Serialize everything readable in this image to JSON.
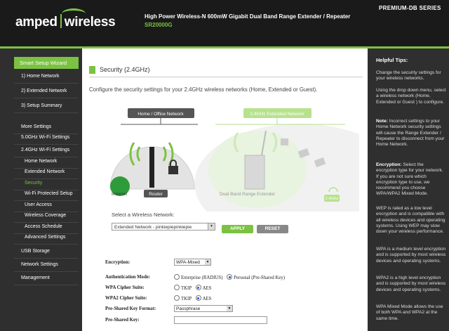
{
  "header": {
    "brand_left": "amped",
    "brand_right": "wireless",
    "product_title": "High Power Wireless-N 600mW Gigabit Dual Band Range Extender / Repeater",
    "model": "SR20000G",
    "series": "PREMIUM-DB SERIES"
  },
  "sidebar": {
    "wizard": "Smart Setup Wizard",
    "items": [
      {
        "label": "1) Home Network"
      },
      {
        "label": "2) Extended Network"
      },
      {
        "label": "3) Setup Summary"
      },
      {
        "label": "More Settings"
      },
      {
        "label": "5.0GHz Wi-Fi Settings"
      },
      {
        "label": "2.4GHz Wi-Fi Settings"
      },
      {
        "label": "Home Network"
      },
      {
        "label": "Extended Network"
      },
      {
        "label": "Security"
      },
      {
        "label": "Wi-Fi Protected Setup"
      },
      {
        "label": "User Access"
      },
      {
        "label": "Wireless Coverage"
      },
      {
        "label": "Access Schedule"
      },
      {
        "label": "Advanced Settings"
      },
      {
        "label": "USB Storage"
      },
      {
        "label": "Network Settings"
      },
      {
        "label": "Management"
      }
    ]
  },
  "main": {
    "title": "Security (2.4GHz)",
    "description": "Configure the security settings for your 2.4GHz wireless networks (Home, Extended or Guest).",
    "diagram": {
      "home_label": "Home / Office Network",
      "extended_label": "2.4GHz Extended Network",
      "internet": "Internet",
      "router": "Router",
      "extender": "Dual Band Range Extender",
      "badge": "2.4GHz"
    },
    "select_label": "Select a Wireless Network:",
    "selected_network": "Extended Network - pinkiepiepinkiepie",
    "apply": "APPLY",
    "reset": "RESET",
    "form": {
      "encryption_label": "Encryption:",
      "encryption_value": "WPA-Mixed",
      "auth_label": "Authentication Mode:",
      "auth_opt1": "Enterprise (RADIUS)",
      "auth_opt2": "Personal (Pre-Shared Key)",
      "wpa_label": "WPA Cipher Suite:",
      "wpa2_label": "WPA2 Cipher Suite:",
      "tkip": "TKIP",
      "aes": "AES",
      "psk_format_label": "Pre-Shared Key Format:",
      "psk_format_value": "Passphrase",
      "psk_label": "Pre-Shared Key:"
    }
  },
  "help": {
    "title": "Helpful Tips:",
    "p1": "Change the security settings for your wireless networks.",
    "p2": "Using the drop down menu, select a wireless network (Home, Extended or Guest ) to configure.",
    "p3_bold": "Note:",
    "p3": " Incorrect settings to your Home Network security settings will cause the Range Extender / Repeater to disconnect from your Home Network.",
    "p4_bold": "Encryption:",
    "p4": " Select the encryption type for your network. If you are not sure which encryption type to use, we recommend you choose WPA/WPA2 Mixed Mode.",
    "p5": "WEP is rated as a low level encryption and is compatible with all wireless devices and operating systems. Using WEP may slow down your wireless performance.",
    "p6": "WPA is a medium level encryption and is supported by most wireless devices and operating systems.",
    "p7": "WPA2 is a high level encryption and is supported by most wireless devices and operating systems.",
    "p8": "WPA Mixed Mode allows the use of both WPA and WPA2 at the same time."
  }
}
